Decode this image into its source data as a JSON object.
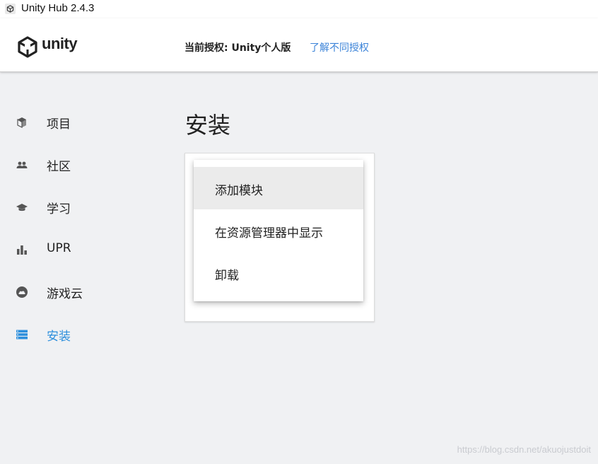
{
  "window": {
    "title": "Unity Hub 2.4.3"
  },
  "header": {
    "logo_text": "unity",
    "license_text": "当前授权: Unity个人版",
    "license_link": "了解不同授权"
  },
  "sidebar": {
    "items": [
      {
        "label": "项目",
        "icon": "cube-icon",
        "active": false
      },
      {
        "label": "社区",
        "icon": "people-icon",
        "active": false
      },
      {
        "label": "学习",
        "icon": "graduation-cap-icon",
        "active": false
      },
      {
        "label": "UPR",
        "icon": "bar-chart-icon",
        "active": false
      },
      {
        "label": "游戏云",
        "icon": "cloud-icon",
        "active": false
      },
      {
        "label": "安装",
        "icon": "installs-list-icon",
        "active": true
      }
    ]
  },
  "main": {
    "title": "安装",
    "context_menu": {
      "items": [
        {
          "label": "添加模块",
          "highlighted": true
        },
        {
          "label": "在资源管理器中显示",
          "highlighted": false
        },
        {
          "label": "卸载",
          "highlighted": false
        }
      ]
    }
  },
  "watermark": "https://blog.csdn.net/akuojustdoit",
  "colors": {
    "accent": "#2d8fdc",
    "link": "#3b83d8",
    "background": "#f0f1f3"
  }
}
